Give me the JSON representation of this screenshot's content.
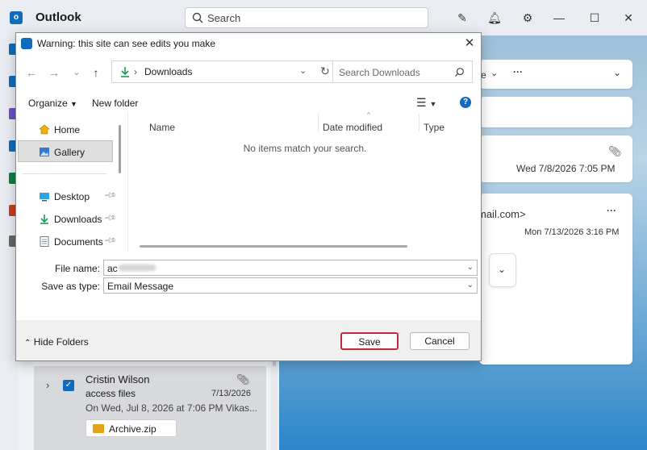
{
  "app": {
    "title": "Outlook",
    "search_placeholder": "Search",
    "brand_color": "#0f6cbd"
  },
  "titlebar_icons": [
    "compose-note-icon",
    "bell-icon",
    "gear-icon",
    "minimize-icon",
    "maximize-icon",
    "close-icon"
  ],
  "reading_pane": {
    "partial_label": "e",
    "date_1": "Wed 7/8/2026 7:05 PM",
    "email_partial": "mail.com>",
    "date_2": "Mon 7/13/2026 3:16 PM"
  },
  "mail_item": {
    "sender": "Cristin Wilson",
    "subject": "access files",
    "date": "7/13/2026",
    "preview": "On Wed, Jul 8, 2026 at 7:06 PM Vikas...",
    "attachment": "Archive.zip",
    "selected": true
  },
  "dialog": {
    "title": "Warning: this site can see edits you make",
    "location": "Downloads",
    "search_placeholder": "Search Downloads",
    "toolbar": {
      "organize": "Organize",
      "new_folder": "New folder"
    },
    "nav": {
      "quick": [
        {
          "label": "Home",
          "icon": "home-icon"
        },
        {
          "label": "Gallery",
          "icon": "gallery-icon",
          "selected": true
        }
      ],
      "pinned": [
        {
          "label": "Desktop",
          "icon": "desktop-icon"
        },
        {
          "label": "Downloads",
          "icon": "download-icon"
        },
        {
          "label": "Documents",
          "icon": "documents-icon"
        }
      ]
    },
    "columns": [
      "Name",
      "Date modified",
      "Type"
    ],
    "empty_message": "No items match your search.",
    "file_name_label": "File name:",
    "file_name_value": "ac",
    "save_type_label": "Save as type:",
    "save_type_value": "Email Message",
    "hide_folders": "Hide Folders",
    "save_button": "Save",
    "cancel_button": "Cancel"
  }
}
